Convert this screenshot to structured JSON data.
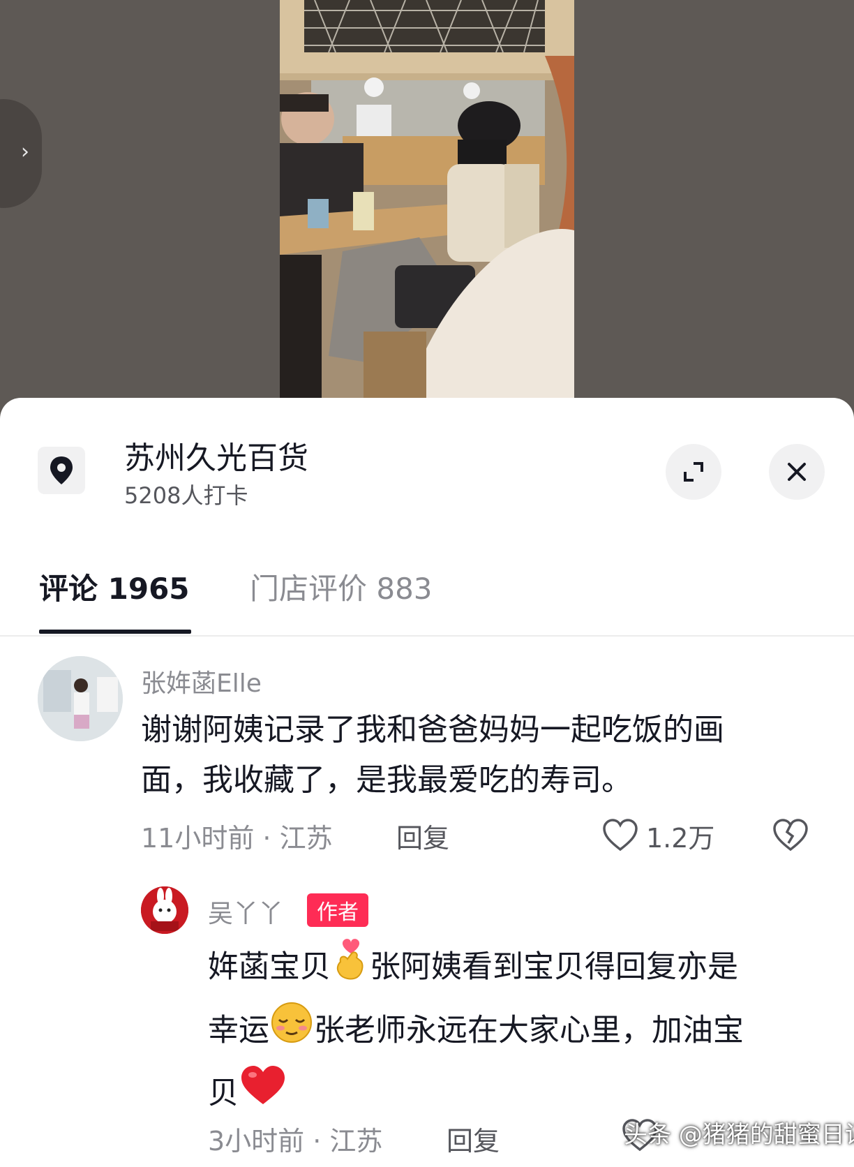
{
  "location": {
    "title": "苏州久光百货",
    "checkins": "5208人打卡"
  },
  "tabs": [
    {
      "label": "评论 1965",
      "active": true
    },
    {
      "label": "门店评价 883",
      "active": false
    }
  ],
  "comments": [
    {
      "user": "张姩菡Elle",
      "text_line1": "谢谢阿姨记录了我和爸爸妈妈一起吃饭的画",
      "text_line2": "面，我收藏了，是我最爱吃的寿司。",
      "meta": "11小时前 · 江苏",
      "reply_label": "回复",
      "likes": "1.2万"
    }
  ],
  "reply": {
    "user": "吴丫丫",
    "badge": "作者",
    "seg1": "姩菡宝贝",
    "seg2": "张阿姨看到宝贝得回复亦是",
    "seg3": "幸运",
    "seg4": "张老师永远在大家心里，加油宝",
    "seg5": "贝",
    "meta": "3小时前 · 江苏",
    "reply_label": "回复"
  },
  "watermark": "头条 @猪猪的甜蜜日记",
  "icons": [
    "chevron-right-icon",
    "location-pin-icon",
    "expand-icon",
    "close-icon",
    "heart-icon",
    "broken-heart-icon",
    "finger-heart-emoji",
    "shy-smile-emoji",
    "red-heart-emoji"
  ],
  "colors": {
    "accent": "#fe2c55",
    "text": "#161823",
    "muted": "#8a8b91"
  }
}
